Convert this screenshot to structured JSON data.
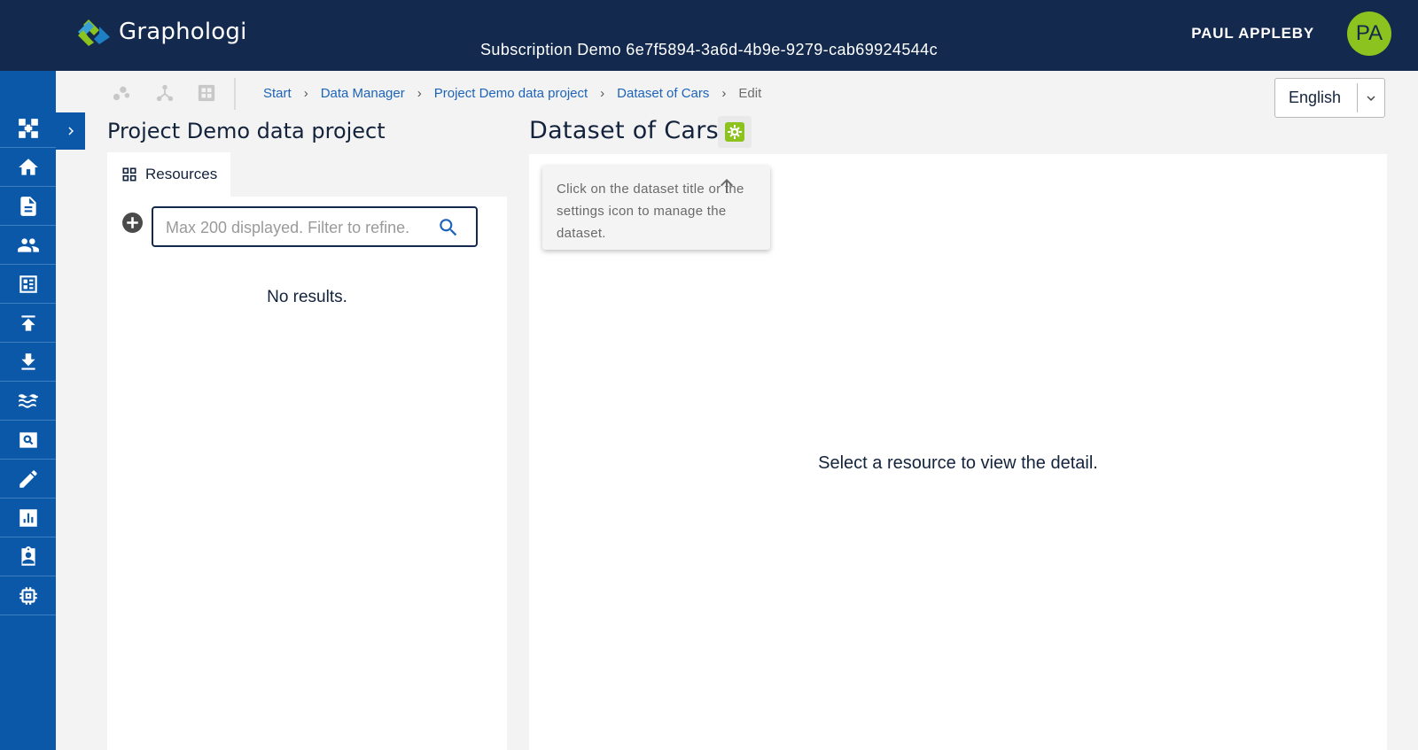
{
  "header": {
    "app_name": "Graphologi",
    "subscription": "Subscription Demo 6e7f5894-3a6d-4b9e-9279-cab69924544c",
    "user_name": "PAUL APPLEBY",
    "avatar_initials": "PA",
    "colors": {
      "topbar": "#132a4e",
      "accent": "#8cc31e",
      "nav": "#0b58a8"
    }
  },
  "nav": {
    "items": [
      {
        "icon": "graph-icon"
      },
      {
        "icon": "home-icon"
      },
      {
        "icon": "document-icon"
      },
      {
        "icon": "people-icon"
      },
      {
        "icon": "dashboard-icon"
      },
      {
        "icon": "upload-icon"
      },
      {
        "icon": "download-icon"
      },
      {
        "icon": "waves-icon"
      },
      {
        "icon": "search-screen-icon"
      },
      {
        "icon": "pencil-icon"
      },
      {
        "icon": "chart-icon"
      },
      {
        "icon": "badge-icon"
      },
      {
        "icon": "chip-icon"
      }
    ]
  },
  "toolbar": {
    "icons": [
      "scatter-icon",
      "network-icon",
      "grid-icon"
    ]
  },
  "breadcrumb": {
    "items": [
      "Start",
      "Data Manager",
      "Project Demo data project",
      "Dataset of Cars"
    ],
    "current": "Edit"
  },
  "language": {
    "selected": "English"
  },
  "left": {
    "project_title": "Project Demo data project",
    "tab_label": "Resources",
    "search_placeholder": "Max 200 displayed. Filter to refine.",
    "search_value": "",
    "empty_text": "No results."
  },
  "right": {
    "dataset_title": "Dataset of Cars",
    "hint": "Click on the dataset title or the settings icon to manage the dataset.",
    "detail_text": "Select a resource to view the detail."
  }
}
